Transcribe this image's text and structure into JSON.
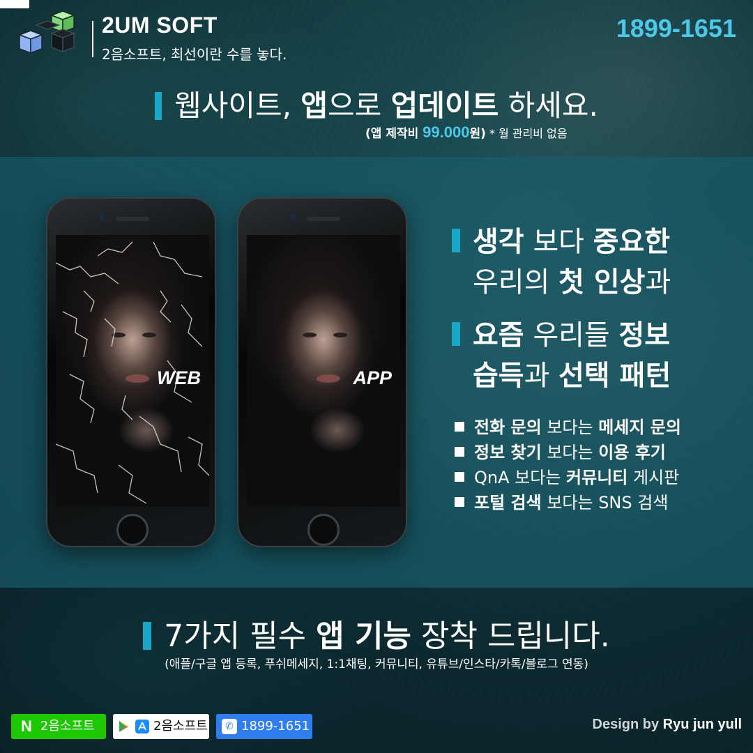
{
  "header": {
    "brand_name": "2UM SOFT",
    "tagline": "2음소프트, 최선이란 수를 놓다.",
    "phone": "1899-1651"
  },
  "headline": {
    "part1": "웹사이트, ",
    "part2": "앱",
    "part3": "으로 ",
    "part4": "업데이트",
    "part5": " 하세요.",
    "sub_open": "(앱 제작비 ",
    "sub_price": "99.000",
    "sub_unit": "원)",
    "sub_note": " * 월 관리비 없음"
  },
  "phones": [
    {
      "label": "WEB"
    },
    {
      "label": "APP"
    }
  ],
  "claims": [
    {
      "line1_a": "생각",
      "line1_b": " 보다 ",
      "line1_c": "중요한",
      "line2_a": "우리의 ",
      "line2_b": "첫 인상",
      "line2_c": "과"
    },
    {
      "line1_a": "요즘",
      "line1_b": " 우리들 ",
      "line1_c": "정보",
      "line2_a": "습득",
      "line2_b": "과 ",
      "line2_c": "선택 패턴"
    }
  ],
  "bullets": [
    {
      "a": "전화 문의",
      "b": " 보다는 ",
      "c": "메세지 문의"
    },
    {
      "a": "정보 찾기",
      "b": " 보다는 ",
      "c": "이용 후기"
    },
    {
      "a": "QnA",
      "b": " 보다는 ",
      "c": "커뮤니티",
      "d": " 게시판"
    },
    {
      "a": "포털 검색",
      "b": " 보다는 ",
      "c": "SNS 검색"
    }
  ],
  "features": {
    "t1": "7가지 ",
    "t2": "필수 ",
    "t3": "앱 기능",
    "t4": " 장착 드립니다.",
    "sub": "(애플/구글 앱 등록, 푸쉬메세지, 1:1채팅, 커뮤니티, 유튜브/인스타/카톡/블로그 연동)"
  },
  "footer": {
    "naver_icon": "N",
    "naver_label": "2음소프트",
    "store_label": "2음소프트",
    "call_label": "1899-1651",
    "design_prefix": "Design by ",
    "designer": "Ryu jun yull"
  },
  "colors": {
    "accent": "#19a7c7",
    "price": "#4cc8e8",
    "naver": "#1ec800",
    "call": "#2f7ef0"
  },
  "icons": [
    "logo-cubes-icon",
    "naver-icon",
    "play-store-icon",
    "app-store-icon",
    "phone-icon"
  ]
}
